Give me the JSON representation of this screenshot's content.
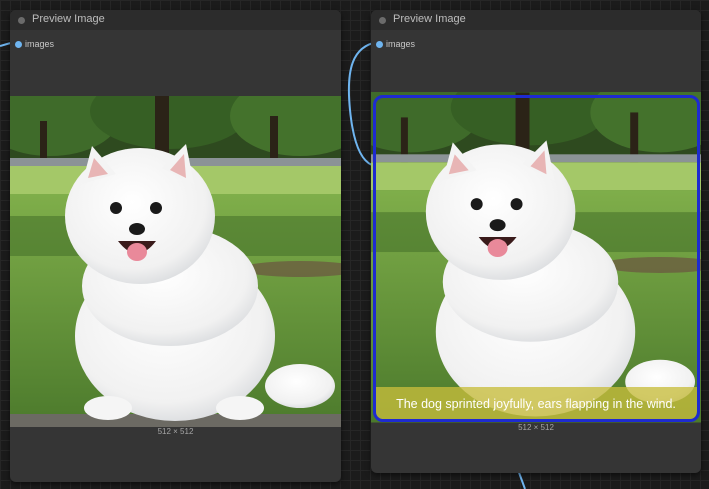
{
  "nodes": [
    {
      "title": "Preview Image",
      "input_label": "images",
      "image_size": "512 × 512",
      "image_description": "white fluffy dog sitting in park"
    },
    {
      "title": "Preview Image",
      "input_label": "images",
      "image_size": "512 × 512",
      "caption": "The dog sprinted joyfully, ears flapping in the wind."
    }
  ],
  "colors": {
    "canvas_bg": "#1b1b1b",
    "node_bg": "#353535",
    "header_bg": "#2c2c2c",
    "link": "#6fb5f0",
    "selection": "#1e2bd0",
    "caption_bg": "#c8be3c"
  },
  "icons": {
    "slot": "input-slot-dot-icon",
    "header": "node-status-dot-icon"
  }
}
